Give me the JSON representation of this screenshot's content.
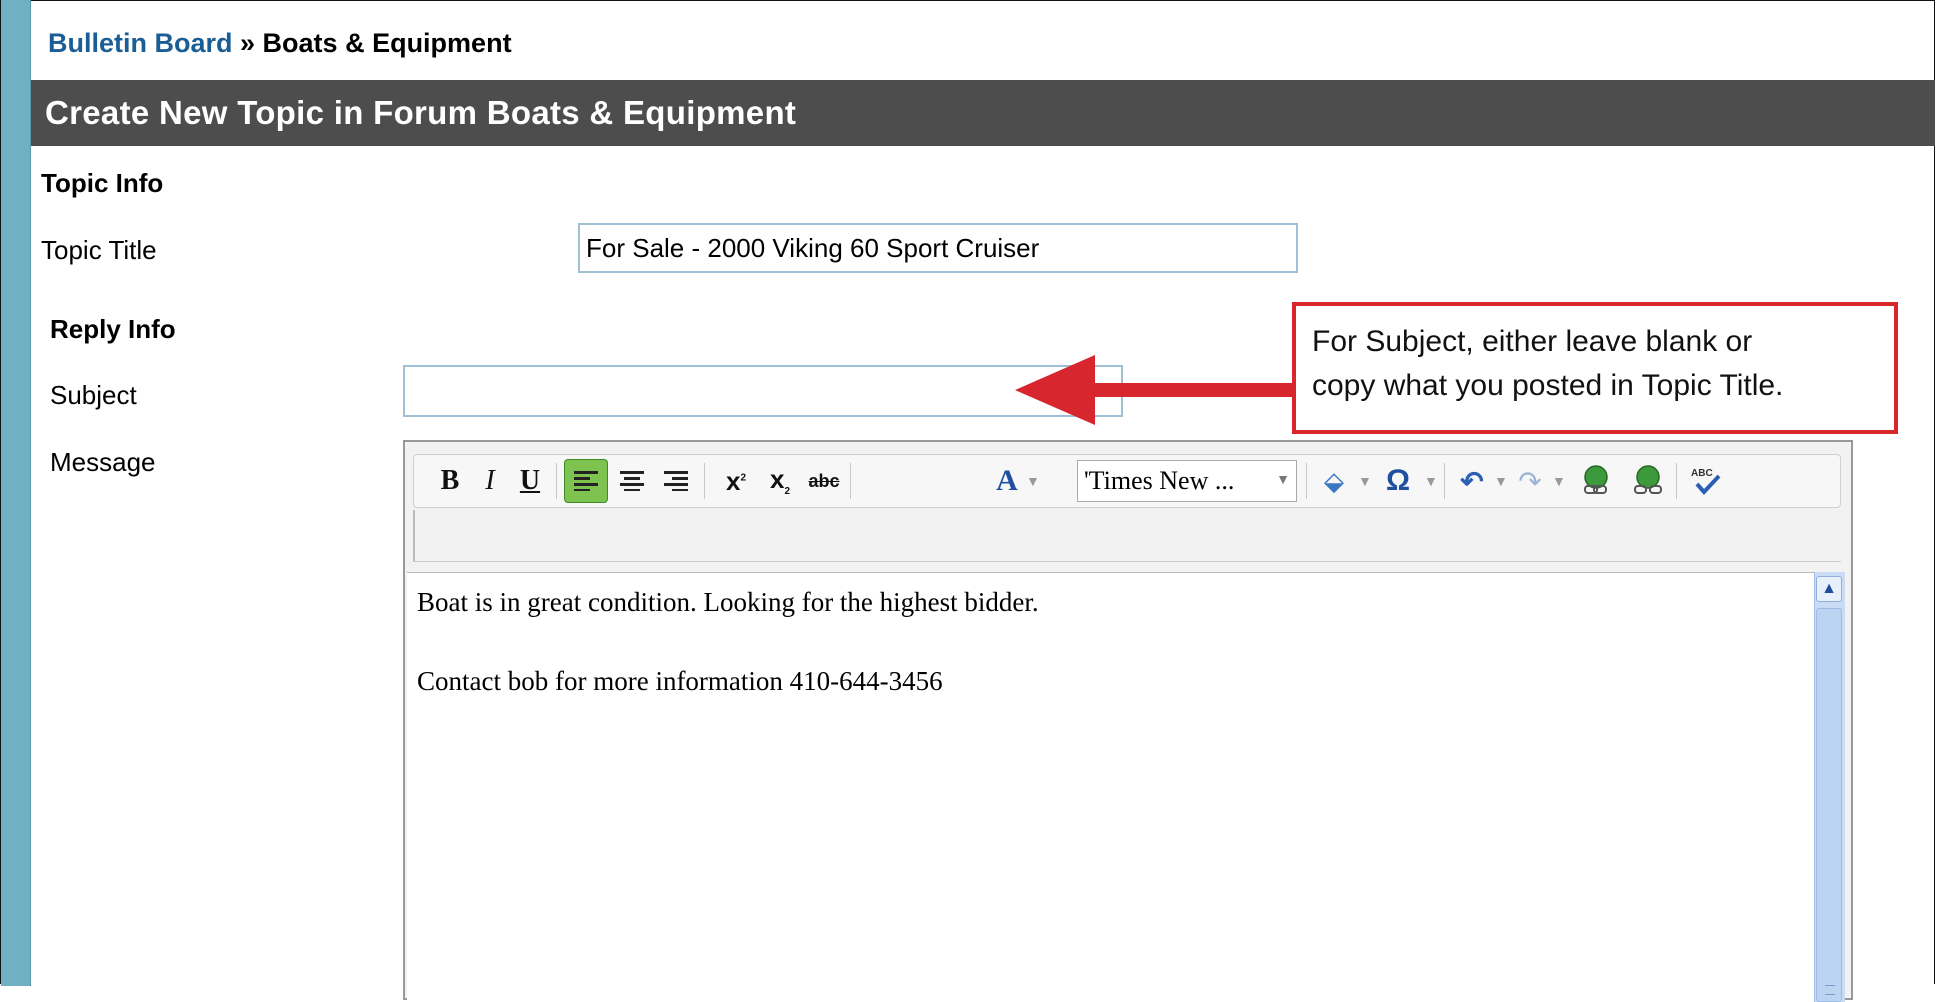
{
  "breadcrumb": {
    "link": "Bulletin Board",
    "separator": " » ",
    "current": "Boats & Equipment"
  },
  "page_title": "Create New Topic in Forum Boats & Equipment",
  "topic_section": {
    "heading": "Topic Info",
    "title_label": "Topic Title",
    "title_value": "For Sale - 2000 Viking 60 Sport Cruiser"
  },
  "reply_section": {
    "heading": "Reply Info",
    "subject_label": "Subject",
    "subject_value": "",
    "message_label": "Message"
  },
  "callout": {
    "line1": "For Subject, either leave blank or",
    "line2": "copy what you posted in Topic Title.",
    "border_color": "#d7262e"
  },
  "editor": {
    "toolbar": {
      "bold": "B",
      "italic": "I",
      "underline": "U",
      "font_color_glyph": "A",
      "font_name": "'Times New ...",
      "special_char_glyph": "Ω",
      "strike_glyph": "abc"
    },
    "content": {
      "line1": "Boat is in great condition. Looking for the highest bidder.",
      "line2": "Contact bob for more information 410-644-3456"
    }
  },
  "colors": {
    "title_bar": "#4d4d4d",
    "link": "#1b5e96",
    "active_button": "#7ec24f",
    "left_strip": "#6fb0c2"
  }
}
